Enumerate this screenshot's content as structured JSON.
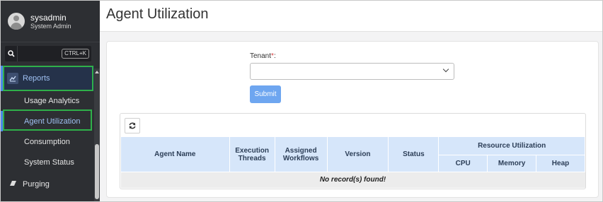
{
  "user": {
    "name": "sysadmin",
    "role": "System Admin"
  },
  "search": {
    "shortcut": "CTRL+K"
  },
  "sidebar": {
    "reports_label": "Reports",
    "items": [
      {
        "label": "Usage Analytics"
      },
      {
        "label": "Agent Utilization"
      },
      {
        "label": "Consumption"
      },
      {
        "label": "System Status"
      }
    ],
    "purging_label": "Purging"
  },
  "page": {
    "title": "Agent Utilization"
  },
  "form": {
    "tenant_label": "Tenant",
    "required_mark": "*",
    "tenant_colon": ":",
    "tenant_value": "",
    "submit_label": "Submit"
  },
  "table": {
    "headers": {
      "agent_name": "Agent Name",
      "execution_threads_1": "Execution",
      "execution_threads_2": "Threads",
      "assigned_workflows_1": "Assigned",
      "assigned_workflows_2": "Workflows",
      "version": "Version",
      "status": "Status",
      "resource_utilization": "Resource Utilization",
      "cpu": "CPU",
      "memory": "Memory",
      "heap": "Heap"
    },
    "empty_message": "No record(s) found!"
  },
  "colors": {
    "accent": "#4d89e8",
    "highlight": "#2fb04a",
    "sidebar_bg": "#2d2f33",
    "header_bg": "#d6e6fa"
  }
}
